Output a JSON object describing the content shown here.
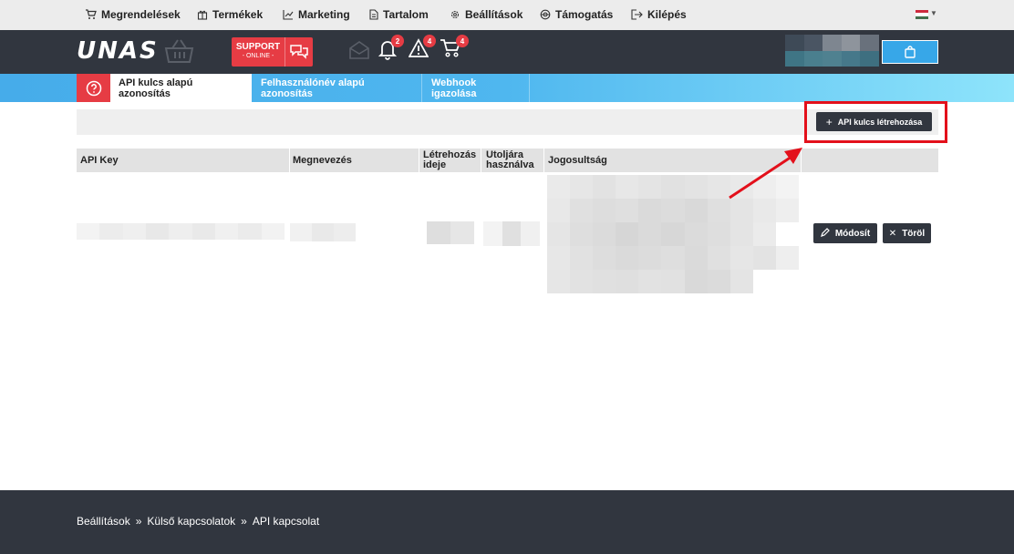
{
  "topmenu": {
    "items": [
      {
        "label": "Megrendelések",
        "icon": "cart-icon"
      },
      {
        "label": "Termékek",
        "icon": "gift-icon"
      },
      {
        "label": "Marketing",
        "icon": "chart-icon"
      },
      {
        "label": "Tartalom",
        "icon": "document-icon"
      },
      {
        "label": "Beállítások",
        "icon": "gear-icon"
      },
      {
        "label": "Támogatás",
        "icon": "lifebuoy-icon"
      },
      {
        "label": "Kilépés",
        "icon": "logout-icon"
      }
    ],
    "language_flag": "hungarian-flag-icon"
  },
  "header": {
    "logo": "UNAS",
    "support": {
      "line1": "SUPPORT",
      "line2": "- ONLINE -"
    },
    "badges": {
      "notifications": "2",
      "warnings": "4",
      "orders": "4"
    }
  },
  "tabs": {
    "items": [
      {
        "label": "API kulcs alapú azonosítás",
        "active": true
      },
      {
        "label": "Felhasználónév alapú azonosítás",
        "active": false
      },
      {
        "label": "Webhook igazolása",
        "active": false
      }
    ]
  },
  "toolbar": {
    "create_label": "API kulcs létrehozása"
  },
  "table": {
    "headers": [
      "API Key",
      "Megnevezés",
      "Létrehozás ideje",
      "Utoljára használva",
      "Jogosultság"
    ],
    "header_lines": {
      "created": [
        "Létrehozás",
        "ideje"
      ],
      "last_used": [
        "Utoljára",
        "használva"
      ]
    },
    "rows": [
      {
        "api_key": "[redacted]",
        "name": "[redacted]",
        "created": "[redacted]",
        "last_used": "[redacted]",
        "permissions": "[redacted]",
        "edit_label": "Módosít",
        "delete_label": "Töröl"
      }
    ]
  },
  "footer": {
    "breadcrumb": [
      "Beállítások",
      "Külső kapcsolatok",
      "API kapcsolat"
    ],
    "separator": "»"
  },
  "colors": {
    "accent_red": "#e63c44",
    "dark": "#31363f",
    "tab_blue": "#46acea",
    "highlight_red": "#e3101b"
  }
}
